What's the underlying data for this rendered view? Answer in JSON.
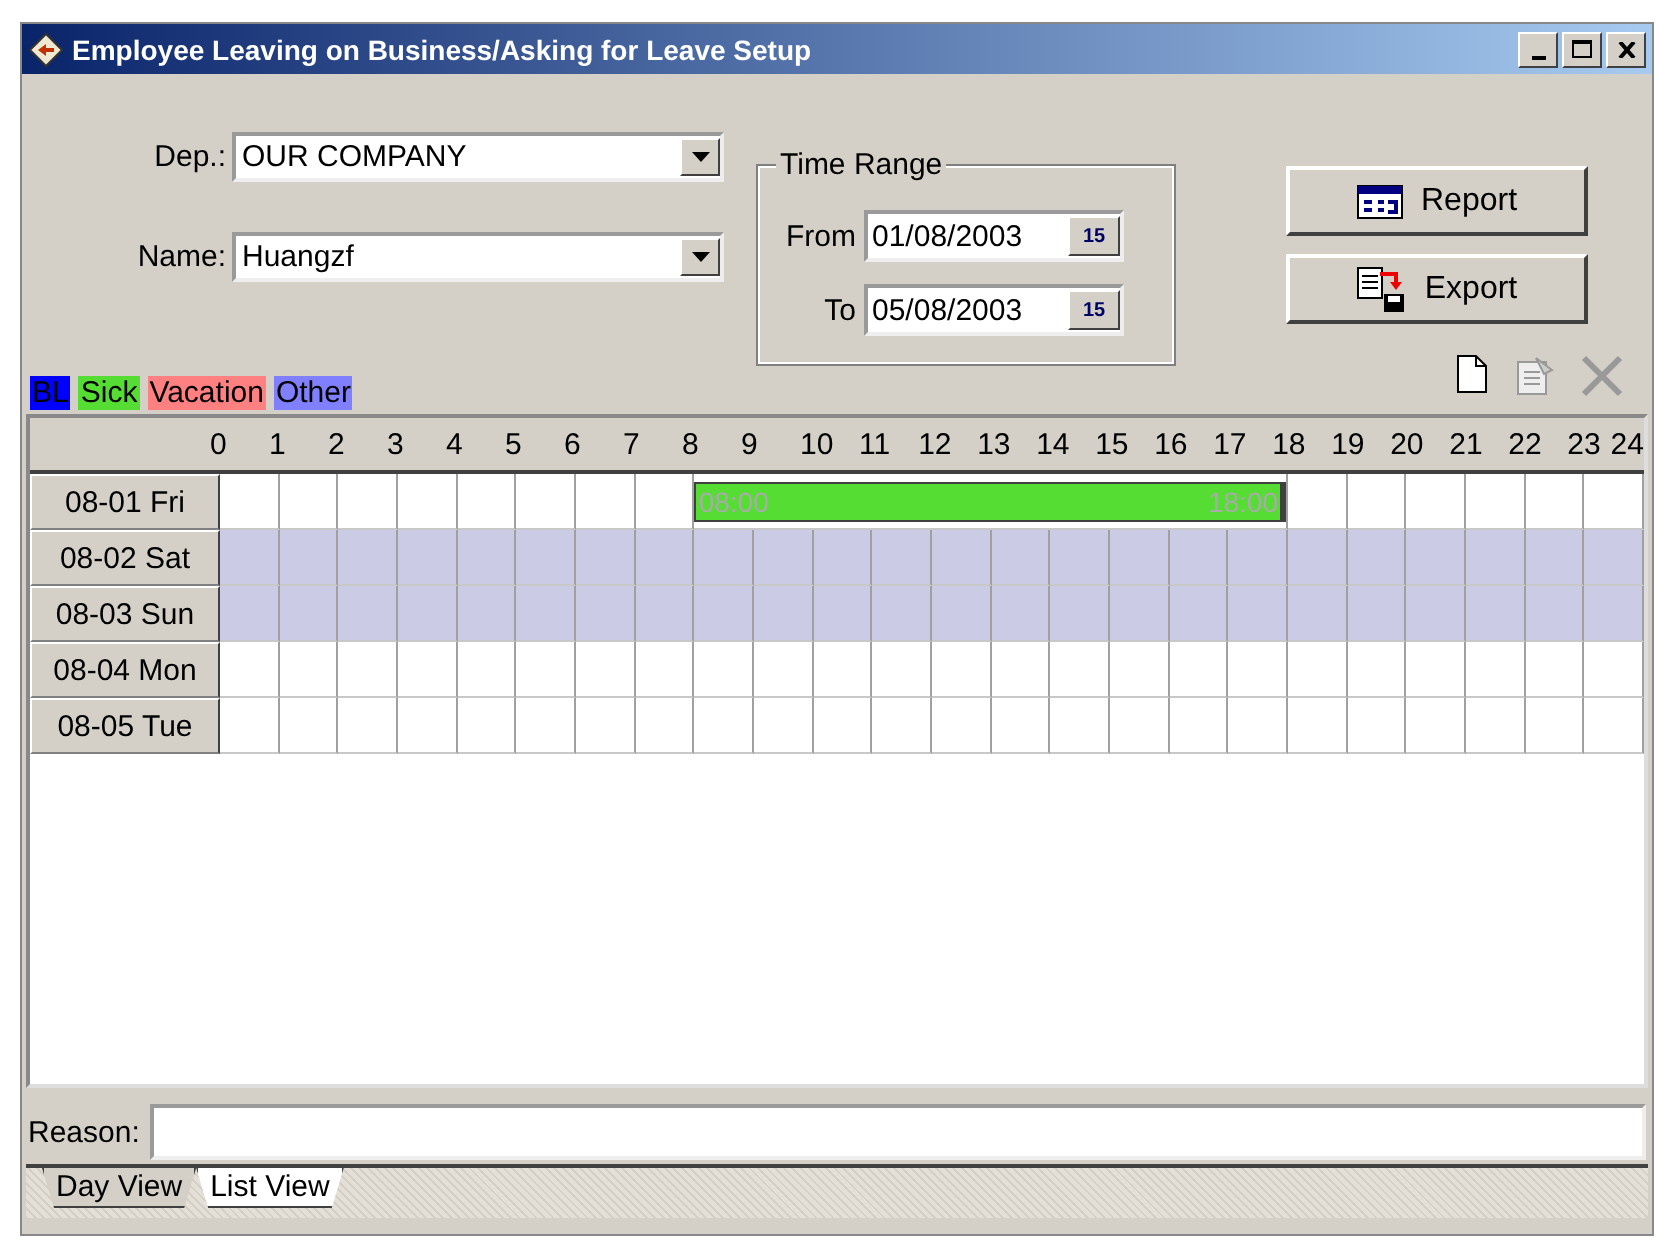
{
  "window": {
    "title": "Employee Leaving on Business/Asking for Leave Setup"
  },
  "filters": {
    "department": {
      "label": "Dep.:",
      "value": "OUR COMPANY"
    },
    "name": {
      "label": "Name:",
      "value": "Huangzf"
    }
  },
  "time_range": {
    "title": "Time Range",
    "from": {
      "label": "From",
      "value": "01/08/2003",
      "calendar_button": "15"
    },
    "to": {
      "label": "To",
      "value": "05/08/2003",
      "calendar_button": "15"
    }
  },
  "buttons": [
    {
      "label": "Report",
      "kind": "report"
    },
    {
      "label": "Export",
      "kind": "export"
    }
  ],
  "legend": [
    {
      "label": "BL",
      "color": "#0000ff"
    },
    {
      "label": "Sick",
      "color": "#55dd33"
    },
    {
      "label": "Vacation",
      "color": "#ff8080"
    },
    {
      "label": "Other",
      "color": "#8080ff"
    }
  ],
  "toolbar": [
    {
      "kind": "new",
      "disabled": false
    },
    {
      "kind": "properties",
      "disabled": true
    },
    {
      "kind": "delete",
      "disabled": true
    }
  ],
  "hours": [
    "0",
    "1",
    "2",
    "3",
    "4",
    "5",
    "6",
    "7",
    "8",
    "9",
    "10",
    "11",
    "12",
    "13",
    "14",
    "15",
    "16",
    "17",
    "18",
    "19",
    "20",
    "21",
    "22",
    "23",
    "24"
  ],
  "days": [
    {
      "label": "08-01 Fri",
      "weekend": false,
      "entries": [
        {
          "start": "08:00",
          "end": "18:00",
          "color": "#55dd33"
        }
      ]
    },
    {
      "label": "08-02 Sat",
      "weekend": true
    },
    {
      "label": "08-03 Sun",
      "weekend": true
    },
    {
      "label": "08-04 Mon",
      "weekend": false
    },
    {
      "label": "08-05 Tue",
      "weekend": false
    }
  ],
  "reason": {
    "label": "Reason:"
  },
  "tabs": [
    {
      "label": "Day View",
      "selected": true
    },
    {
      "label": "List View",
      "selected": false
    }
  ]
}
